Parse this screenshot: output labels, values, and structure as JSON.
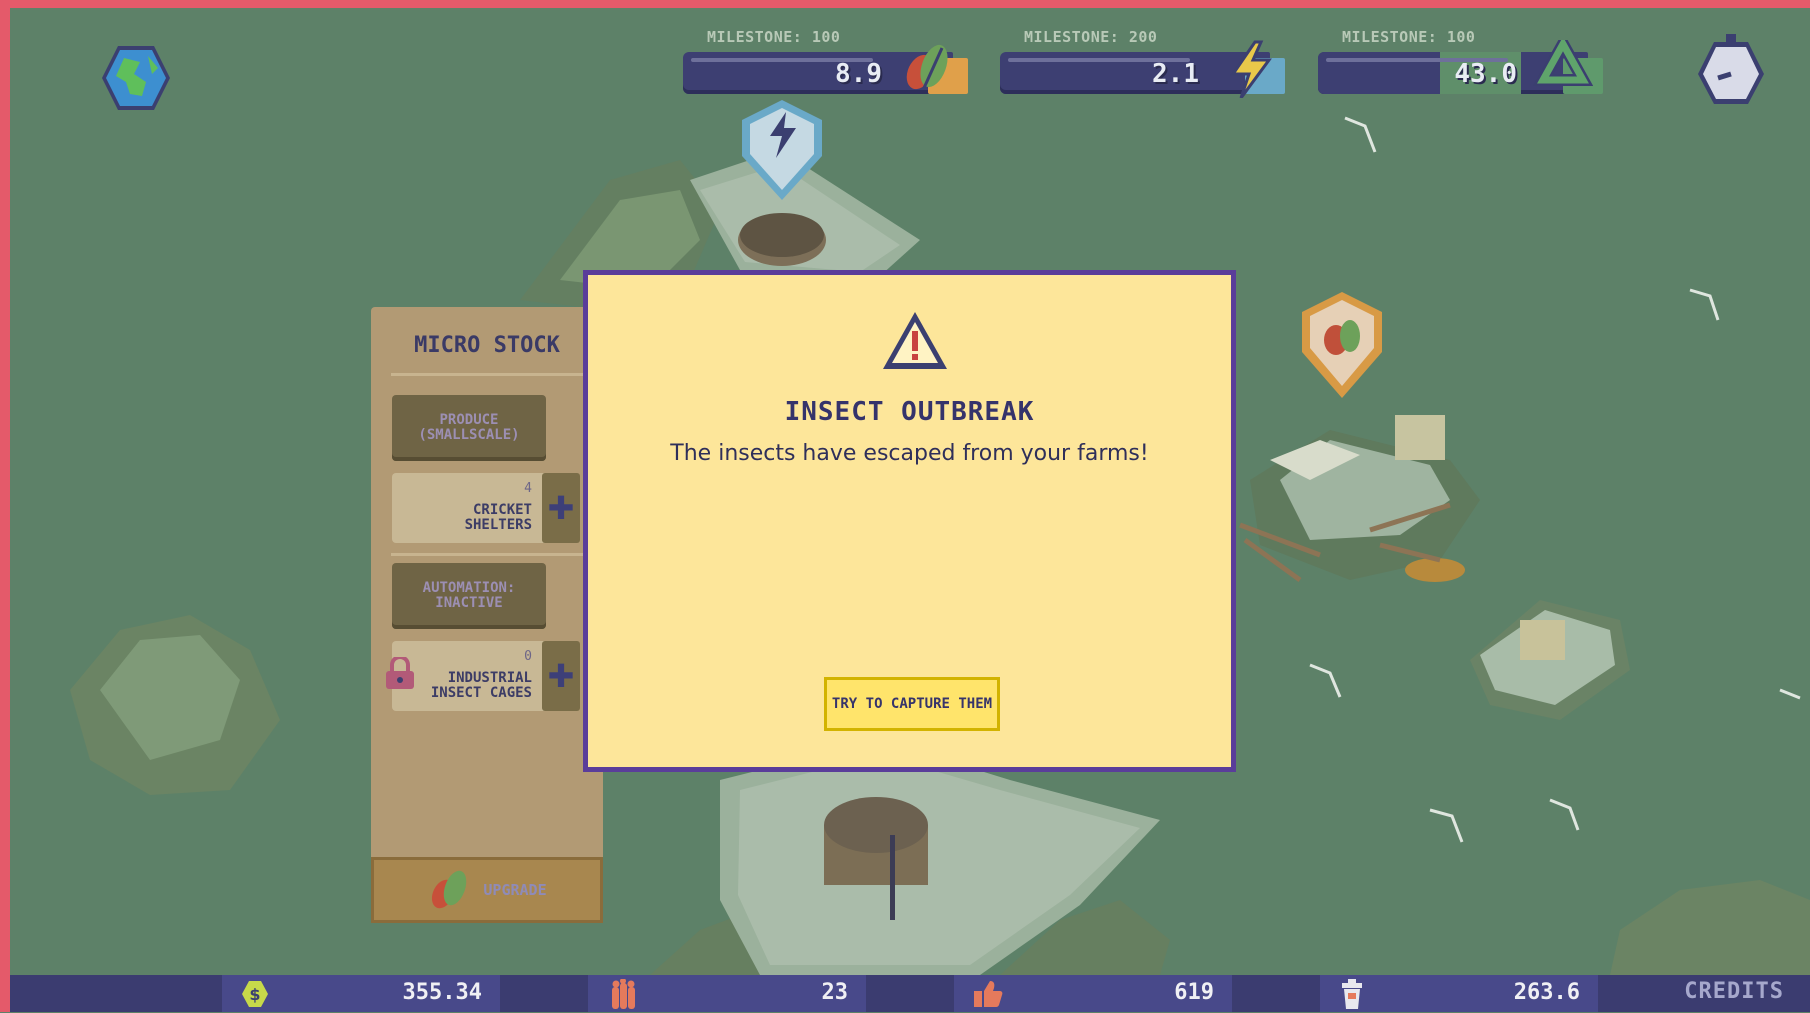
{
  "hud": {
    "globe_icon": "globe-icon",
    "timer_icon": "stopwatch-icon",
    "meters": [
      {
        "milestone_label": "MILESTONE: 100",
        "value": "8.9",
        "icon": "food-leaf-icon",
        "accent": "#e0a04a"
      },
      {
        "milestone_label": "MILESTONE: 200",
        "value": "2.1",
        "icon": "lightning-icon",
        "accent": "#6aa9c8"
      },
      {
        "milestone_label": "MILESTONE: 100",
        "value": "43.0",
        "icon": "recycle-icon",
        "accent": "#5f9a6c",
        "fill_fraction": 0.45
      }
    ]
  },
  "map_markers": [
    {
      "icon": "lightning-icon",
      "color": "#6aa9c8"
    },
    {
      "icon": "food-leaf-icon",
      "color": "#e0a04a"
    }
  ],
  "panel": {
    "title": "MICRO STOCK",
    "produce_button": "PRODUCE (SMALLSCALE)",
    "items": [
      {
        "count": "4",
        "name": "CRICKET SHELTERS",
        "locked": false
      },
      {
        "count": "0",
        "name": "INDUSTRIAL INSECT CAGES",
        "locked": true
      }
    ],
    "automation_button": "AUTOMATION: INACTIVE",
    "upgrade_label": "UPGRADE"
  },
  "modal": {
    "icon": "warning-icon",
    "title": "INSECT OUTBREAK",
    "message": "The insects have escaped from your farms!",
    "action_label": "TRY TO CAPTURE THEM"
  },
  "bottom_bar": {
    "money": "355.34",
    "population": "23",
    "approval": "619",
    "waste": "263.6",
    "credits_label": "CREDITS"
  },
  "colors": {
    "ocean": "#5d8168",
    "modal_bg": "#fde69a",
    "modal_border": "#5a3d9a",
    "hud_bar": "#3d3f72",
    "frame": "#e45a6a"
  }
}
